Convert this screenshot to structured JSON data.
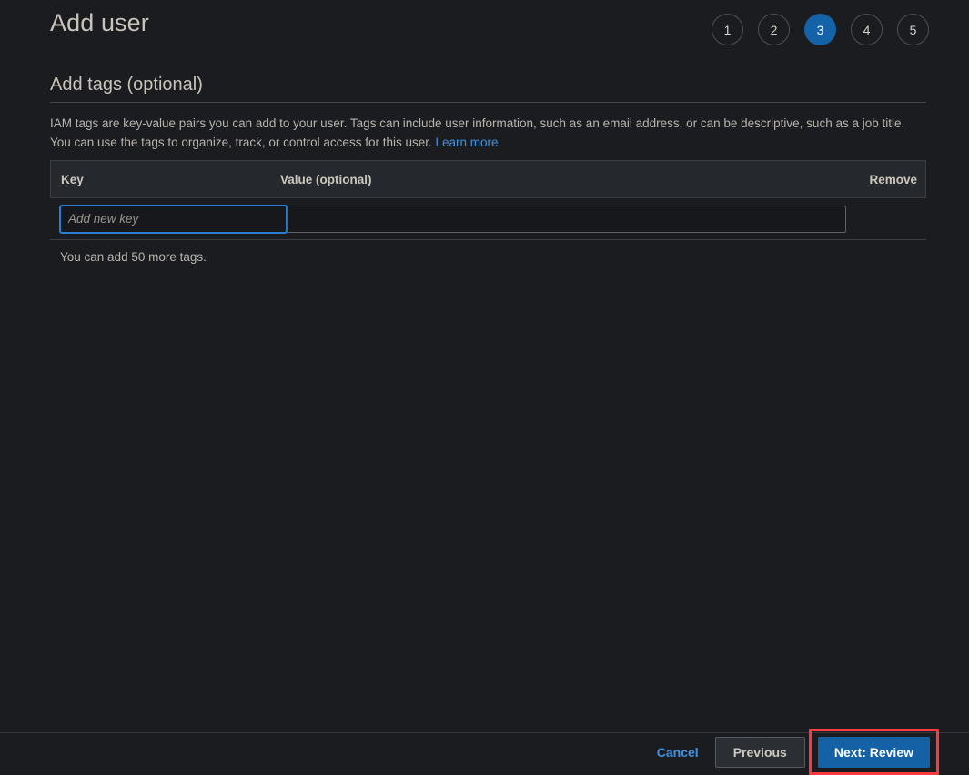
{
  "header": {
    "title": "Add user",
    "steps": [
      {
        "label": "1",
        "active": false
      },
      {
        "label": "2",
        "active": false
      },
      {
        "label": "3",
        "active": true
      },
      {
        "label": "4",
        "active": false
      },
      {
        "label": "5",
        "active": false
      }
    ],
    "active_step_color": "#1462a8"
  },
  "section": {
    "title": "Add tags (optional)",
    "description_part1": "IAM tags are key-value pairs you can add to your user. Tags can include user information, such as an email address, or can be descriptive, such as a job title. You can use the tags to organize, track, or control access for this user. ",
    "learn_more_label": "Learn more",
    "link_color": "#3f93e3"
  },
  "tags_table": {
    "columns": {
      "key": "Key",
      "value": "Value (optional)",
      "remove": "Remove"
    },
    "rows": [
      {
        "key_value": "",
        "key_placeholder": "Add new key",
        "key_focused": true,
        "value_value": "",
        "value_placeholder": ""
      }
    ],
    "note": "You can add 50 more tags."
  },
  "footer": {
    "cancel_label": "Cancel",
    "previous_label": "Previous",
    "next_label": "Next: Review",
    "next_highlight_color": "#fb3b40",
    "next_button_color": "#1461a6"
  }
}
